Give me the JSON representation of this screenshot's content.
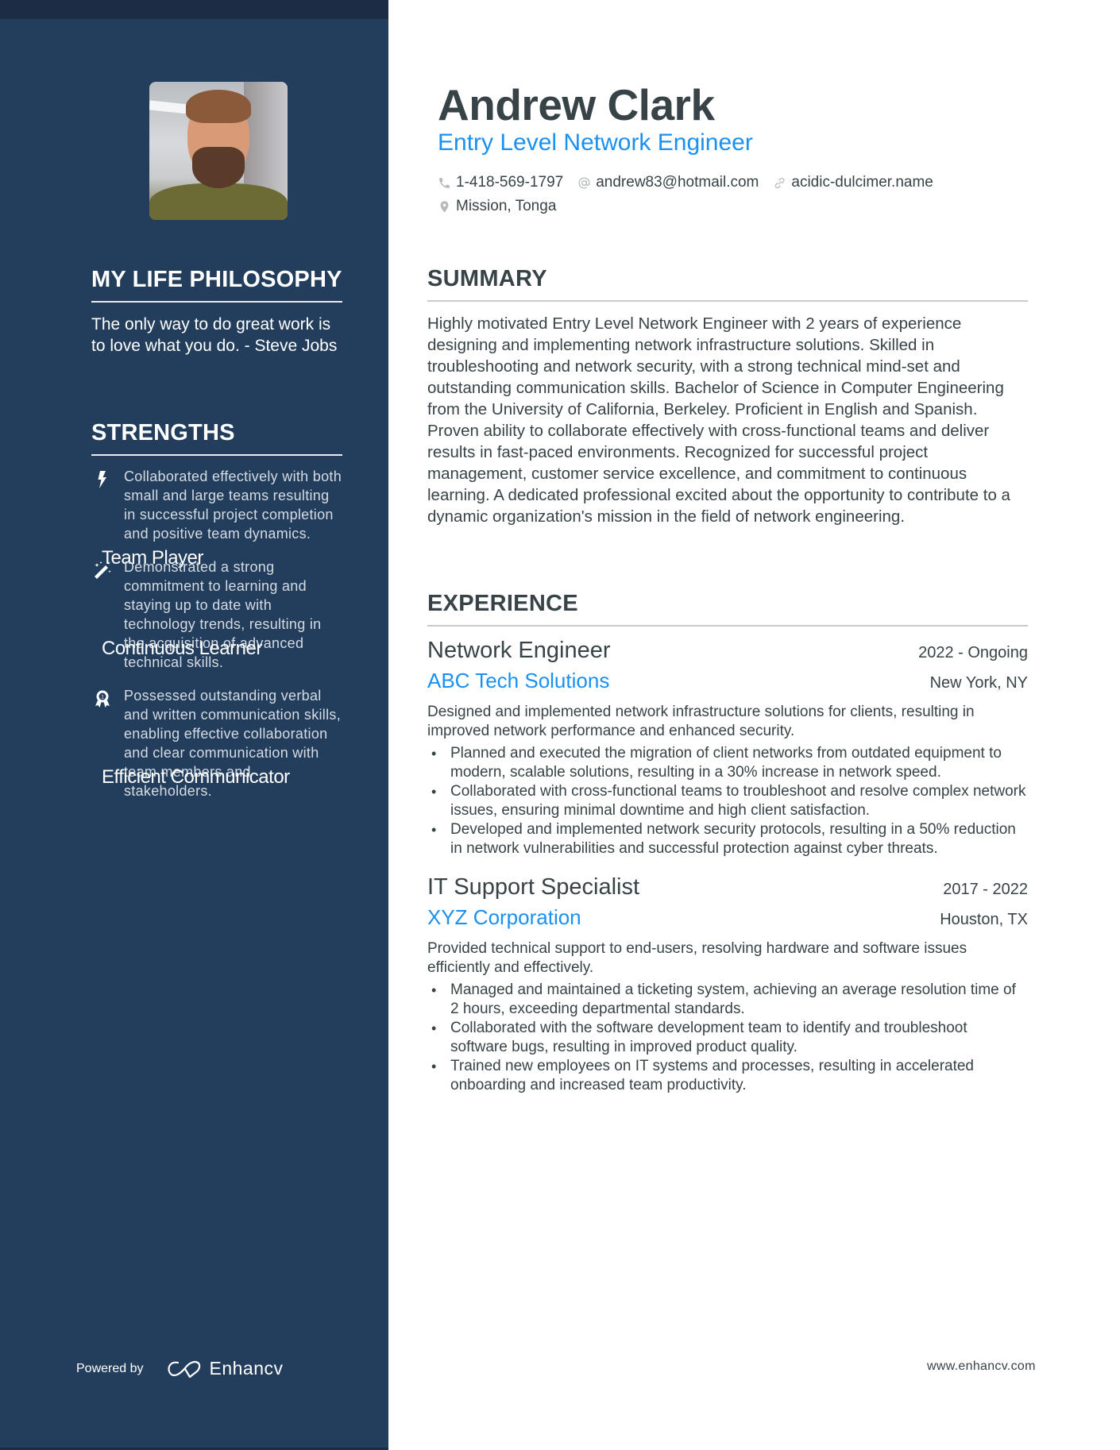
{
  "sidebar": {
    "photo_alt": "Andrew Clark profile photo",
    "philosophy": {
      "title": "MY LIFE PHILOSOPHY",
      "text": "The only way to do great work is to love what you do. - Steve Jobs"
    },
    "strengths": {
      "title": "STRENGTHS",
      "items": [
        {
          "icon": "lightning-bolt-icon",
          "name": "Team Player",
          "description": "Collaborated effectively with both small and large teams resulting in successful project completion and positive team dynamics."
        },
        {
          "icon": "magic-wand-icon",
          "name": "Continuous Learner",
          "description": "Demonstrated a strong commitment to learning and staying up to date with technology trends, resulting in the acquisition of advanced technical skills."
        },
        {
          "icon": "award-ribbon-icon",
          "name": "Efficient Communicator",
          "description": "Possessed outstanding verbal and written communication skills, enabling effective collaboration and clear communication with team members and stakeholders."
        }
      ]
    },
    "footer": {
      "powered_by": "Powered by",
      "brand": "Enhancv"
    }
  },
  "header": {
    "name": "Andrew Clark",
    "title": "Entry Level Network Engineer",
    "contacts": {
      "phone": "1-418-569-1797",
      "email": "andrew83@hotmail.com",
      "website": "acidic-dulcimer.name",
      "location": "Mission, Tonga"
    }
  },
  "summary": {
    "title": "SUMMARY",
    "text": "Highly motivated Entry Level Network Engineer with 2 years of experience designing and implementing network infrastructure solutions. Skilled in troubleshooting and network security, with a strong technical mind-set and outstanding communication skills. Bachelor of Science in Computer Engineering from the University of California, Berkeley. Proficient in English and Spanish. Proven ability to collaborate effectively with cross-functional teams and deliver results in fast-paced environments. Recognized for successful project management, customer service excellence, and commitment to continuous learning. A dedicated professional excited about the opportunity to contribute to a dynamic organization's mission in the field of network engineering."
  },
  "experience": {
    "title": "EXPERIENCE",
    "jobs": [
      {
        "position": "Network Engineer",
        "dates": "2022 - Ongoing",
        "company": "ABC Tech Solutions",
        "location": "New York, NY",
        "description": "Designed and implemented network infrastructure solutions for clients, resulting in improved network performance and enhanced security.",
        "bullets": [
          "Planned and executed the migration of client networks from outdated equipment to modern, scalable solutions, resulting in a 30% increase in network speed.",
          "Collaborated with cross-functional teams to troubleshoot and resolve complex network issues, ensuring minimal downtime and high client satisfaction.",
          "Developed and implemented network security protocols, resulting in a 50% reduction in network vulnerabilities and successful protection against cyber threats."
        ]
      },
      {
        "position": "IT Support Specialist",
        "dates": "2017 - 2022",
        "company": "XYZ Corporation",
        "location": "Houston, TX",
        "description": "Provided technical support to end-users, resolving hardware and software issues efficiently and effectively.",
        "bullets": [
          "Managed and maintained a ticketing system, achieving an average resolution time of 2 hours, exceeding departmental standards.",
          "Collaborated with the software development team to identify and troubleshoot software bugs, resulting in improved product quality.",
          "Trained new employees on IT systems and processes, resulting in accelerated onboarding and increased team productivity."
        ]
      }
    ]
  },
  "footer": {
    "website": "www.enhancv.com"
  },
  "colors": {
    "sidebar_bg": "#223e5c",
    "accent": "#1a91f0",
    "text": "#384347"
  }
}
